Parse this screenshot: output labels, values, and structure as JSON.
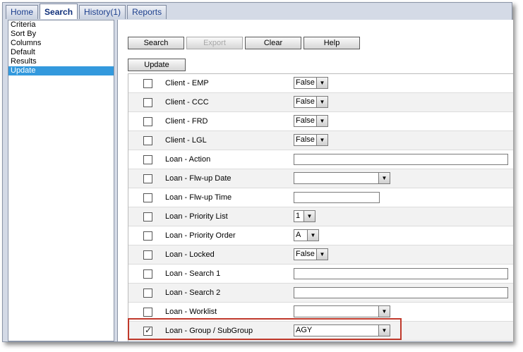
{
  "tabs": [
    {
      "label": "Home",
      "active": false
    },
    {
      "label": "Search",
      "active": true
    },
    {
      "label": "History(1)",
      "active": false
    },
    {
      "label": "Reports",
      "active": false
    }
  ],
  "nav": [
    {
      "label": "Criteria",
      "selected": false
    },
    {
      "label": "Sort By",
      "selected": false
    },
    {
      "label": "Columns",
      "selected": false
    },
    {
      "label": "Default",
      "selected": false
    },
    {
      "label": "Results",
      "selected": false
    },
    {
      "label": "Update",
      "selected": true
    }
  ],
  "toolbar": {
    "search": "Search",
    "export": "Export",
    "clear": "Clear",
    "help": "Help",
    "update": "Update"
  },
  "rows": [
    {
      "label": "Client - EMP",
      "checked": false,
      "control": "select-small",
      "value": "False"
    },
    {
      "label": "Client - CCC",
      "checked": false,
      "control": "select-small",
      "value": "False"
    },
    {
      "label": "Client - FRD",
      "checked": false,
      "control": "select-small",
      "value": "False"
    },
    {
      "label": "Client - LGL",
      "checked": false,
      "control": "select-small",
      "value": "False"
    },
    {
      "label": "Loan - Action",
      "checked": false,
      "control": "text-wide",
      "value": ""
    },
    {
      "label": "Loan - Flw-up Date",
      "checked": false,
      "control": "select-wide",
      "value": ""
    },
    {
      "label": "Loan - Flw-up Time",
      "checked": false,
      "control": "text-mid",
      "value": ""
    },
    {
      "label": "Loan - Priority List",
      "checked": false,
      "control": "select-tiny",
      "value": "1"
    },
    {
      "label": "Loan - Priority Order",
      "checked": false,
      "control": "select-tiny2",
      "value": "A"
    },
    {
      "label": "Loan - Locked",
      "checked": false,
      "control": "select-small",
      "value": "False"
    },
    {
      "label": "Loan - Search 1",
      "checked": false,
      "control": "text-wide",
      "value": ""
    },
    {
      "label": "Loan - Search 2",
      "checked": false,
      "control": "text-wide",
      "value": ""
    },
    {
      "label": "Loan - Worklist",
      "checked": false,
      "control": "select-wide",
      "value": ""
    },
    {
      "label": "Loan - Group / SubGroup",
      "checked": true,
      "control": "select-wide",
      "value": "AGY"
    }
  ],
  "colors": {
    "accent": "#3399dd",
    "highlight": "#c0392b"
  }
}
